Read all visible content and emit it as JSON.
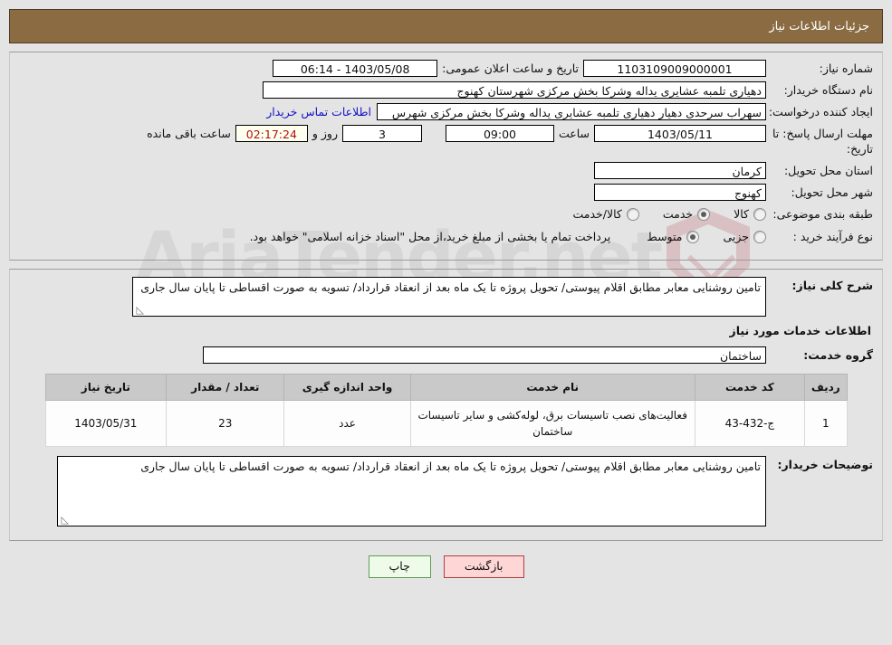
{
  "header": {
    "title": "جزئیات اطلاعات نیاز"
  },
  "form": {
    "need_number_label": "شماره نیاز:",
    "need_number_value": "1103109009000001",
    "public_announce_label": "تاریخ و ساعت اعلان عمومی:",
    "public_announce_value": "1403/05/08 - 06:14",
    "buyer_org_label": "نام دستگاه خریدار:",
    "buyer_org_value": "دهیاری تلمبه عشایری یداله وشرکا بخش مرکزی شهرستان کهنوج",
    "creator_label": "ایجاد کننده درخواست:",
    "creator_value": "سهراب سرحدی دهیار دهیاری تلمبه عشایری یداله وشرکا بخش مرکزی شهرس",
    "contact_link": "اطلاعات تماس خریدار",
    "deadline_label": "مهلت ارسال پاسخ: تا تاریخ:",
    "deadline_date": "1403/05/11",
    "hour_label": "ساعت",
    "deadline_time": "09:00",
    "days_remaining": "3",
    "days_and_label": "روز و",
    "countdown": "02:17:24",
    "remaining_label": "ساعت باقی مانده",
    "province_label": "استان محل تحویل:",
    "province_value": "کرمان",
    "city_label": "شهر محل تحویل:",
    "city_value": "کهنوج",
    "category_label": "طبقه بندی موضوعی:",
    "category_options": [
      {
        "label": "کالا",
        "selected": false
      },
      {
        "label": "خدمت",
        "selected": true
      },
      {
        "label": "کالا/خدمت",
        "selected": false
      }
    ],
    "process_label": "نوع فرآیند خرید :",
    "process_options": [
      {
        "label": "جزیی",
        "selected": false
      },
      {
        "label": "متوسط",
        "selected": true
      }
    ],
    "treasury_note": "پرداخت تمام یا بخشی از مبلغ خرید،از محل \"اسناد خزانه اسلامی\" خواهد بود."
  },
  "need_summary": {
    "label": "شرح کلی نیاز:",
    "value": "تامین روشنایی معابر مطابق اقلام پیوستی/ تحویل پروژه تا یک ماه بعد از انعقاد قرارداد/ تسویه به صورت اقساطی تا پایان سال جاری"
  },
  "services_section": {
    "heading": "اطلاعات خدمات مورد نیاز",
    "group_label": "گروه خدمت:",
    "group_value": "ساختمان"
  },
  "table": {
    "columns": [
      "ردیف",
      "کد خدمت",
      "نام خدمت",
      "واحد اندازه گیری",
      "تعداد / مقدار",
      "تاریخ نیاز"
    ],
    "rows": [
      {
        "radif": "1",
        "code": "ج-432-43",
        "name": "فعالیت‌های نصب تاسیسات برق، لوله‌کشی و سایر تاسیسات ساختمان",
        "unit": "عدد",
        "qty": "23",
        "date": "1403/05/31"
      }
    ]
  },
  "buyer_notes": {
    "label": "توضیحات خریدار:",
    "value": "تامین روشنایی معابر مطابق اقلام پیوستی/ تحویل پروژه تا یک ماه بعد از انعقاد قرارداد/ تسویه به صورت اقساطی تا پایان سال جاری"
  },
  "buttons": {
    "back": "بازگشت",
    "print": "چاپ"
  },
  "watermark": {
    "text": "AriaTender.net"
  },
  "colors": {
    "header_bg": "#8a6b42",
    "page_bg": "#e4e4e4",
    "link": "#1313c8",
    "countdown_text": "#b01010",
    "countdown_bg": "#fffff0",
    "back_btn_bg": "#ffd6d6",
    "print_btn_bg": "#eefbe9",
    "table_header_bg": "#c9c9c9"
  }
}
